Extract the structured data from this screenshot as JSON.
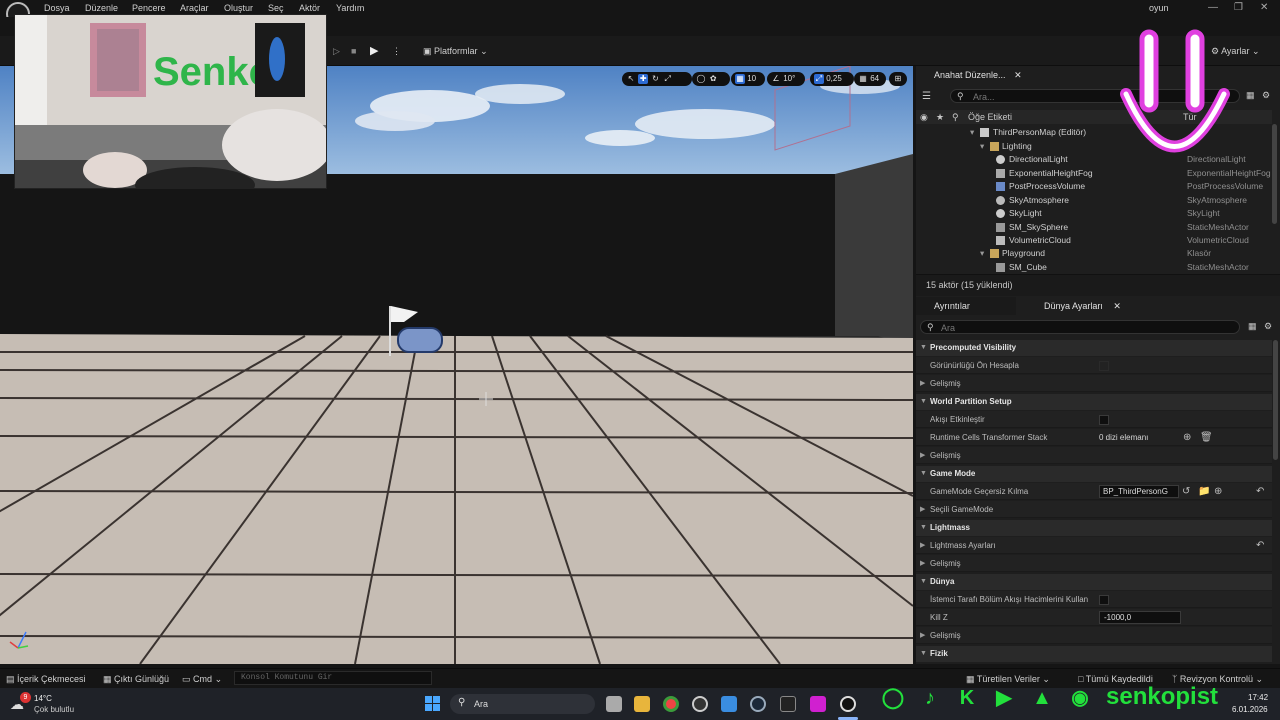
{
  "menubar": {
    "items": [
      "Dosya",
      "Düzenle",
      "Pencere",
      "Araçlar",
      "Oluştur",
      "Seç",
      "Aktör",
      "Yardım"
    ],
    "project_name": "oyun"
  },
  "toolbar": {
    "platforms_label": "Platformlar",
    "settings_label": "Ayarlar"
  },
  "viewport": {
    "grid_snap": "10",
    "rotation_snap": "10°",
    "scale_snap": "0,25",
    "camera_speed": "64"
  },
  "outliner": {
    "tab_label": "Anahat Düzenle...",
    "search_placeholder": "Ara...",
    "col_label": "Öğe Etiketi",
    "col_type": "Tür",
    "rows": [
      {
        "name": "ThirdPersonMap (Editör)",
        "type": ""
      },
      {
        "name": "Lighting",
        "type": ""
      },
      {
        "name": "DirectionalLight",
        "type": "DirectionalLight"
      },
      {
        "name": "ExponentialHeightFog",
        "type": "ExponentialHeightFog"
      },
      {
        "name": "PostProcessVolume",
        "type": "PostProcessVolume"
      },
      {
        "name": "SkyAtmosphere",
        "type": "SkyAtmosphere"
      },
      {
        "name": "SkyLight",
        "type": "SkyLight"
      },
      {
        "name": "SM_SkySphere",
        "type": "StaticMeshActor"
      },
      {
        "name": "VolumetricCloud",
        "type": "VolumetricCloud"
      },
      {
        "name": "Playground",
        "type": "Klasör"
      },
      {
        "name": "SM_Cube",
        "type": "StaticMeshActor"
      }
    ],
    "actor_count": "15 aktör (15 yüklendi)"
  },
  "details": {
    "tab_details": "Ayrıntılar",
    "tab_world": "Dünya Ayarları",
    "search_placeholder": "Ara",
    "sections": {
      "precomputed": "Precomputed Visibility",
      "precompute_vis": "Görünürlüğü Ön Hesapla",
      "advanced": "Gelişmiş",
      "world_partition": "World Partition Setup",
      "enable_streaming": "Akışı Etkinleştir",
      "runtime_cells": "Runtime Cells Transformer Stack",
      "runtime_cells_value": "0 dizi elemanı",
      "game_mode": "Game Mode",
      "gamemode_override": "GameMode Geçersiz Kılma",
      "gamemode_value": "BP_ThirdPersonG",
      "selected_gamemode": "Seçili GameMode",
      "lightmass": "Lightmass",
      "lightmass_settings": "Lightmass Ayarları",
      "world": "Dünya",
      "client_side": "İstemci Tarafı Bölüm Akışı Hacimlerini Kullan",
      "kill_z": "Kill Z",
      "kill_z_value": "-1000,0",
      "physics": "Fizik"
    }
  },
  "statusbar": {
    "content_drawer": "İçerik Çekmecesi",
    "output_log": "Çıktı Günlüğü",
    "cmd": "Cmd",
    "console_placeholder": "Konsol Komutunu Gir",
    "derived_data": "Türetilen Veriler",
    "all_saved": "Tümü Kaydedildi",
    "revision_control": "Revizyon Kontrolü"
  },
  "taskbar": {
    "temperature": "14°C",
    "weather": "Çok bulutlu",
    "weather_badge": "9",
    "search_label": "Ara",
    "time": "17:42",
    "date": "6.01.2026"
  },
  "overlay": {
    "brand": "senkopist",
    "wall_text": "Senko"
  }
}
